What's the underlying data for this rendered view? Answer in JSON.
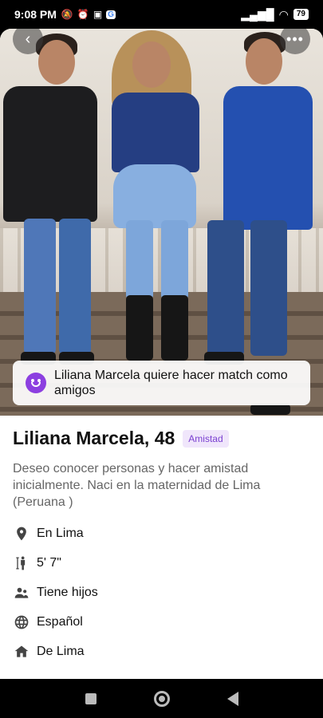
{
  "status_bar": {
    "time": "9:08 PM",
    "left_icons": [
      "mute-icon",
      "alarm-icon",
      "app-icon",
      "google-icon"
    ],
    "battery": "79",
    "right_icons": [
      "signal-icon",
      "wifi-icon",
      "battery-icon"
    ]
  },
  "profile": {
    "photo_alt": "profile-photo",
    "back_icon": "chevron-left-icon",
    "more_icon": "more-icon",
    "match_banner": "Liliana Marcela quiere hacer match como amigos",
    "name_age": "Liliana Marcela, 48",
    "badge": "Amistad",
    "bio": "Deseo conocer personas y hacer amistad inicialmente. Naci en la maternidad de Lima (Peruana )",
    "facts": [
      {
        "icon": "location-icon",
        "label": "En Lima"
      },
      {
        "icon": "height-icon",
        "label": "5' 7\""
      },
      {
        "icon": "children-icon",
        "label": "Tiene hijos"
      },
      {
        "icon": "language-icon",
        "label": "Español"
      },
      {
        "icon": "home-icon",
        "label": "De Lima"
      }
    ]
  },
  "colors": {
    "accent": "#8c3fe0",
    "badge_bg": "#f0e6fb",
    "badge_text": "#7a3fd1"
  }
}
